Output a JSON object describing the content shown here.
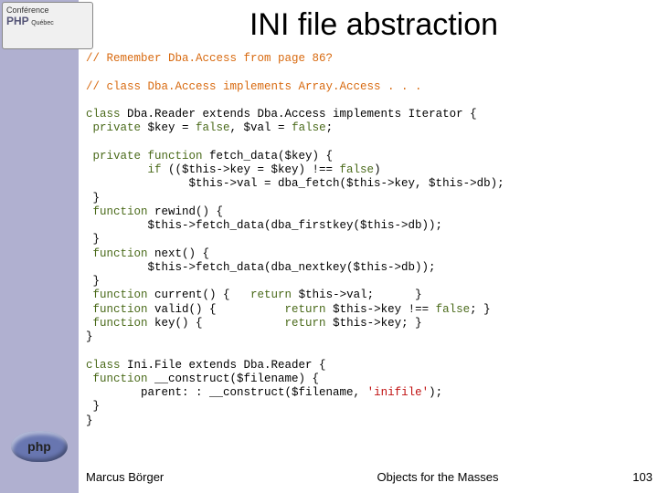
{
  "header": {
    "conference_top": "Conférence",
    "conference_main": "PHP",
    "conference_region": "Québec",
    "php_logo": "php"
  },
  "title": "INI file abstraction",
  "code": {
    "comment1": "// Remember Dba.Access from page 86?",
    "comment2": "// class Dba.Access implements Array.Access . . .",
    "l01a": "class ",
    "l01b": "Dba.Reader extends Dba.Access implements Iterator {",
    "l02a": " private ",
    "l02b": "$key = ",
    "l02c": "false",
    "l02d": ", $val = ",
    "l02e": "false",
    "l02f": ";",
    "l04a": " private function ",
    "l04b": "fetch_data($key) {",
    "l05a": "         if ",
    "l05b": "(($this->key = $key) !== ",
    "l05c": "false",
    "l05d": ")",
    "l06": "               $this->val = dba_fetch($this->key, $this->db);",
    "l07": " }",
    "l08a": " function ",
    "l08b": "rewind() {",
    "l09": "         $this->fetch_data(dba_firstkey($this->db));",
    "l10": " }",
    "l11a": " function ",
    "l11b": "next() {",
    "l12": "         $this->fetch_data(dba_nextkey($this->db));",
    "l13": " }",
    "l14a": " function ",
    "l14b": "current() {   ",
    "l14c": "return ",
    "l14d": "$this->val;      }",
    "l15a": " function ",
    "l15b": "valid() {          ",
    "l15c": "return ",
    "l15d": "$this->key !== ",
    "l15e": "false",
    "l15f": "; }",
    "l16a": " function ",
    "l16b": "key() {            ",
    "l16c": "return ",
    "l16d": "$this->key; }",
    "l17": "}",
    "l19a": "class ",
    "l19b": "Ini.File extends Dba.Reader {",
    "l20a": " function ",
    "l20b": "__construct($filename) {",
    "l21a": "        parent: : __construct($filename, ",
    "l21b": "'inifile'",
    "l21c": ");",
    "l22": " }",
    "l23": "}"
  },
  "footer": {
    "author": "Marcus Börger",
    "title": "Objects for the Masses",
    "page": "103"
  }
}
